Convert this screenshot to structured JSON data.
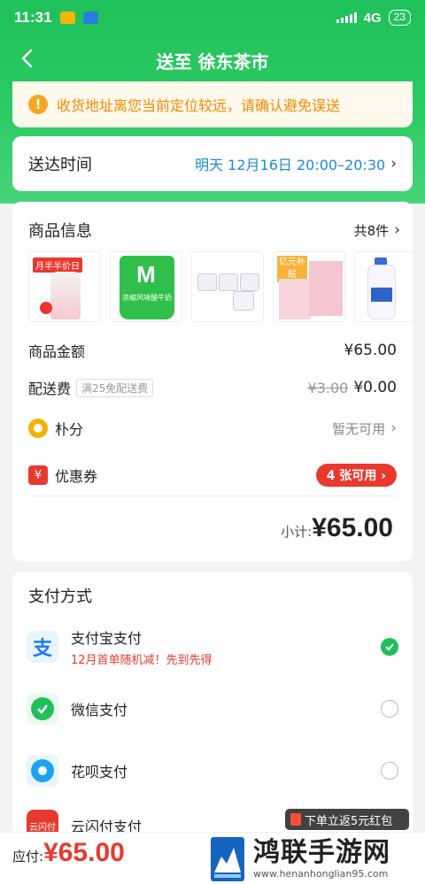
{
  "status_bar": {
    "time": "11:31",
    "network": "4G",
    "battery": "23"
  },
  "header": {
    "title": "送至 徐东茶市"
  },
  "warning": {
    "text": "收货地址离您当前定位较远，请确认避免误送"
  },
  "delivery": {
    "label": "送达时间",
    "value": "明天 12月16日 20:00–20:30"
  },
  "goods": {
    "title": "商品信息",
    "count": "共8件",
    "products": [
      {
        "name": "yogurt-strawberry",
        "label": "月半半价日"
      },
      {
        "name": "yogurt-green-tub",
        "label": "浓缩风味酸牛奶"
      },
      {
        "name": "yogurt-multipack",
        "label": ""
      },
      {
        "name": "pink-box",
        "label": "亿元补贴"
      },
      {
        "name": "milk-bottle",
        "label": ""
      }
    ]
  },
  "summary": {
    "goods_amount_label": "商品金额",
    "goods_amount": "¥65.00",
    "shipping_label": "配送费",
    "shipping_tag": "满25免配送费",
    "shipping_original": "¥3.00",
    "shipping_fee": "¥0.00",
    "points_label": "朴分",
    "points_value": "暂无可用",
    "coupon_label": "优惠券",
    "coupon_badge": "4 张可用",
    "subtotal_label": "小计:",
    "subtotal_value": "¥65.00"
  },
  "payment": {
    "title": "支付方式",
    "methods": [
      {
        "name": "支付宝支付",
        "note": "12月首单随机减！先到先得",
        "selected": true
      },
      {
        "name": "微信支付",
        "note": "",
        "selected": false
      },
      {
        "name": "花呗支付",
        "note": "",
        "selected": false
      },
      {
        "name": "云闪付支付",
        "note": "",
        "selected": false
      }
    ]
  },
  "promo": {
    "text": "下单立返5元红包"
  },
  "footer": {
    "due_label": "应付:",
    "due_value": "¥65.00"
  },
  "watermark": {
    "title": "鸿联手游网",
    "url": "www.henanhonglian95.com"
  },
  "colors": {
    "brand_green": "#1fc15a",
    "price_red": "#e8392f",
    "link_blue": "#1b8ad8",
    "warn_orange": "#f08c00"
  }
}
